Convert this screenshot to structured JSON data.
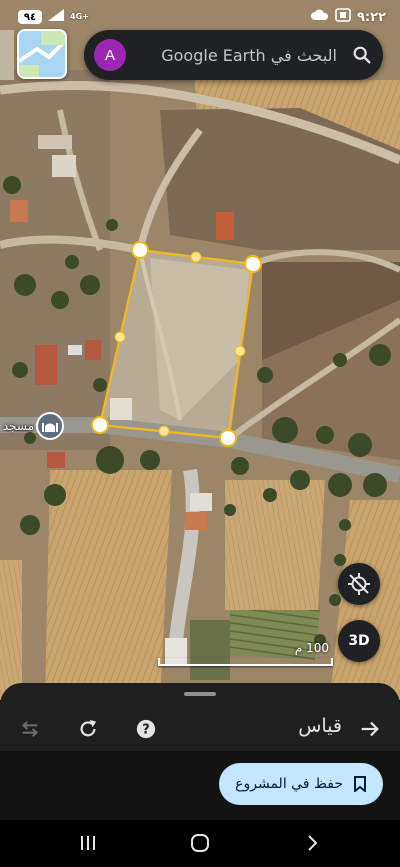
{
  "status_bar": {
    "time": "٩:٢٢",
    "battery": "٩٤",
    "network": "4G+",
    "icons": [
      "cloud-icon",
      "screenshot-icon",
      "signal-icon",
      "battery-icon"
    ]
  },
  "search": {
    "placeholder": "البحث في Google Earth",
    "avatar_letter": "A",
    "avatar_color": "#9c27b0"
  },
  "map": {
    "place_label": "مسجد",
    "place_icon": "mosque-icon",
    "scale_label": "100 م",
    "button_3d": "3D",
    "measure_color": "#f2b91c"
  },
  "sheet": {
    "title": "قياس",
    "toolbar_icons": [
      "undo-icon",
      "redo-icon",
      "help-icon",
      "arrow-right-icon"
    ],
    "save_button": "حفظ في المشروع"
  },
  "nav": {
    "buttons": [
      "recents-icon",
      "home-icon",
      "back-icon"
    ]
  }
}
